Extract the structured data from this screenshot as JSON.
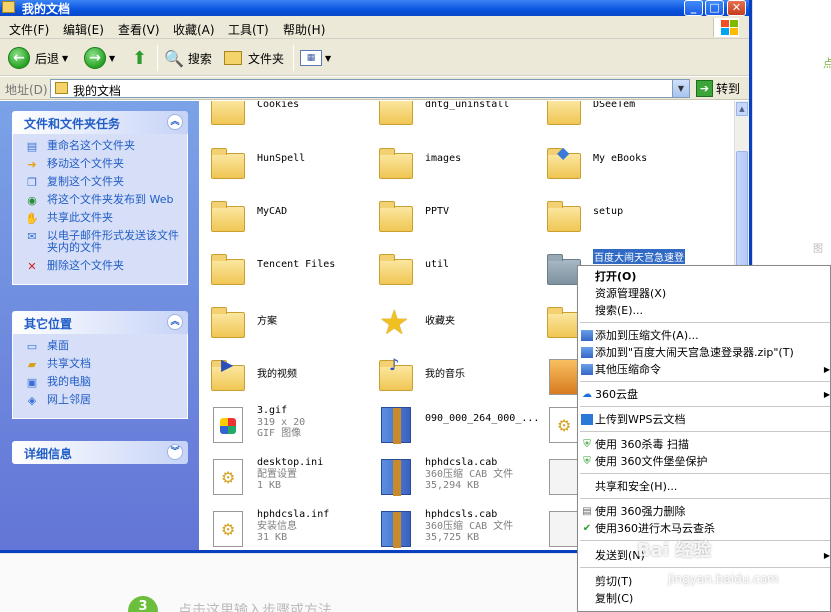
{
  "window": {
    "title": "我的文档"
  },
  "menu": [
    "文件(F)",
    "编辑(E)",
    "查看(V)",
    "收藏(A)",
    "工具(T)",
    "帮助(H)"
  ],
  "toolbar": {
    "back": "后退",
    "search": "搜索",
    "folders": "文件夹"
  },
  "address": {
    "label": "地址(D)",
    "value": "我的文档",
    "go": "转到"
  },
  "tasks": {
    "title": "文件和文件夹任务",
    "items": [
      "重命名这个文件夹",
      "移动这个文件夹",
      "复制这个文件夹",
      "将这个文件夹发布到 Web",
      "共享此文件夹",
      "以电子邮件形式发送该文件夹内的文件",
      "删除这个文件夹"
    ]
  },
  "places": {
    "title": "其它位置",
    "items": [
      "桌面",
      "共享文档",
      "我的电脑",
      "网上邻居"
    ]
  },
  "details": {
    "title": "详细信息"
  },
  "files": [
    {
      "name": "Cookies"
    },
    {
      "name": "dntg_uninstall"
    },
    {
      "name": "DSeeTem"
    },
    {
      "name": "HunSpell"
    },
    {
      "name": "images"
    },
    {
      "name": "My eBooks"
    },
    {
      "name": "MyCAD"
    },
    {
      "name": "PPTV"
    },
    {
      "name": "setup"
    },
    {
      "name": "Tencent Files"
    },
    {
      "name": "util"
    },
    {
      "name": "百度大闹天宫急速登"
    },
    {
      "name": "方案"
    },
    {
      "name": "收藏夹"
    },
    {
      "name": "我的视频"
    },
    {
      "name": "我的音乐"
    },
    {
      "name": "3.gif",
      "sub1": "319 x 20",
      "sub2": "GIF 图像"
    },
    {
      "name": "090_000_264_000_..."
    },
    {
      "name": "desktop.ini",
      "sub1": "配置设置",
      "sub2": "1 KB"
    },
    {
      "name": "hphdcsla.cab",
      "sub1": "360压缩 CAB 文件",
      "sub2": "35,294 KB"
    },
    {
      "name": "hphdcsla.inf",
      "sub1": "安装信息",
      "sub2": "31 KB"
    },
    {
      "name": "hphdcsls.cab",
      "sub1": "360压缩 CAB 文件",
      "sub2": "35,725 KB"
    }
  ],
  "context_menu": [
    "打开(O)",
    "资源管理器(X)",
    "搜索(E)...",
    "添加到压缩文件(A)...",
    "添加到\"百度大闹天宫急速登录器.zip\"(T)",
    "其他压缩命令",
    "360云盘",
    "上传到WPS云文档",
    "使用 360杀毒 扫描",
    "使用 360文件堡垒保护",
    "共享和安全(H)...",
    "使用 360强力删除",
    "使用360进行木马云查杀",
    "发送到(N)",
    "剪切(T)",
    "复制(C)"
  ],
  "background": {
    "step_number": "3",
    "step_hint": "点击这里输入步骤或方法"
  },
  "watermark": {
    "line1": "Bai 经验",
    "line2": "jingyan.baidu.com"
  }
}
